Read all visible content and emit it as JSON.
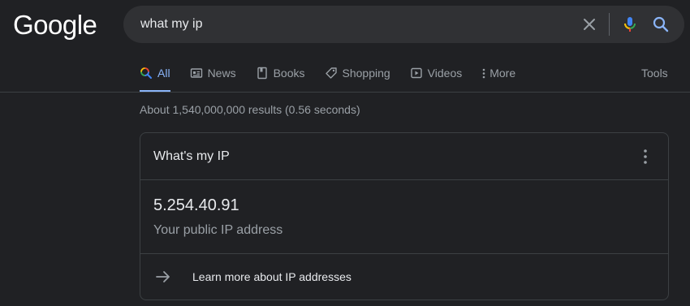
{
  "logo": "Google",
  "search": {
    "query": "what my ip"
  },
  "tabs": [
    {
      "label": "All",
      "icon": "search-icon",
      "active": true
    },
    {
      "label": "News",
      "icon": "news-icon"
    },
    {
      "label": "Books",
      "icon": "book-icon"
    },
    {
      "label": "Shopping",
      "icon": "tag-icon"
    },
    {
      "label": "Videos",
      "icon": "play-icon"
    },
    {
      "label": "More",
      "icon": "kebab-icon"
    }
  ],
  "tools_label": "Tools",
  "result_stats": "About 1,540,000,000 results (0.56 seconds)",
  "card": {
    "title": "What's my IP",
    "ip": "5.254.40.91",
    "caption": "Your public IP address",
    "learn_more": "Learn more about IP addresses"
  },
  "colors": {
    "background": "#202124",
    "accent": "#8ab4f8",
    "searchbar": "#303134"
  }
}
